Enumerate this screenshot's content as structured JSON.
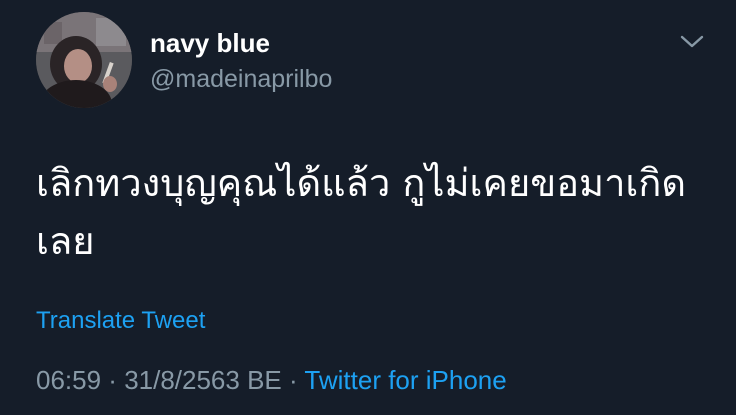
{
  "user": {
    "display_name": "navy blue",
    "handle": "@madeinaprilbo"
  },
  "tweet": {
    "text": "เลิกทวงบุญคุณได้แล้ว กูไม่เคยขอมาเกิดเลย",
    "translate_label": "Translate Tweet",
    "time": "06:59",
    "separator": " · ",
    "date": "31/8/2563 BE",
    "source": "Twitter for iPhone"
  },
  "icons": {
    "menu": "chevron-down-icon",
    "avatar": "profile-photo"
  },
  "colors": {
    "background": "#151d29",
    "primary_text": "#ffffff",
    "secondary_text": "#8899a6",
    "link": "#1da1f2"
  }
}
